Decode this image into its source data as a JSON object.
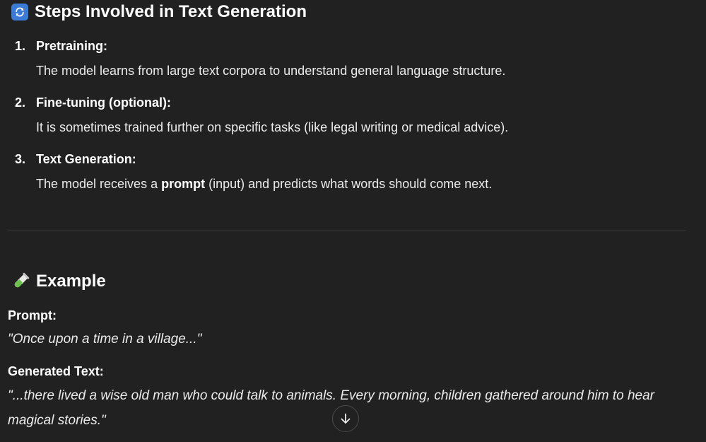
{
  "steps_section": {
    "icon": "refresh-icon",
    "title": "Steps Involved in Text Generation",
    "items": [
      {
        "number": "1.",
        "title": "Pretraining:",
        "description": "The model learns from large text corpora to understand general language structure."
      },
      {
        "number": "2.",
        "title": "Fine-tuning (optional):",
        "description": "It is sometimes trained further on specific tasks (like legal writing or medical advice)."
      },
      {
        "number": "3.",
        "title": "Text Generation:",
        "description_before": "The model receives a ",
        "description_bold": "prompt",
        "description_after": " (input) and predicts what words should come next."
      }
    ]
  },
  "example_section": {
    "icon": "test-tube-icon",
    "title": "Example",
    "prompt_label": "Prompt:",
    "prompt_text": "\"Once upon a time in a village...\"",
    "generated_label": "Generated Text:",
    "generated_line1": "\"...there lived a wise old man who could talk to animals. Every morning, children gathered around him to hear",
    "generated_line2": "magical stories.\""
  },
  "scroll_button": {
    "icon": "arrow-down-icon"
  },
  "colors": {
    "background": "#212121",
    "text": "#ececec",
    "heading": "#ffffff",
    "accent_icon": "#3b7bd6"
  }
}
